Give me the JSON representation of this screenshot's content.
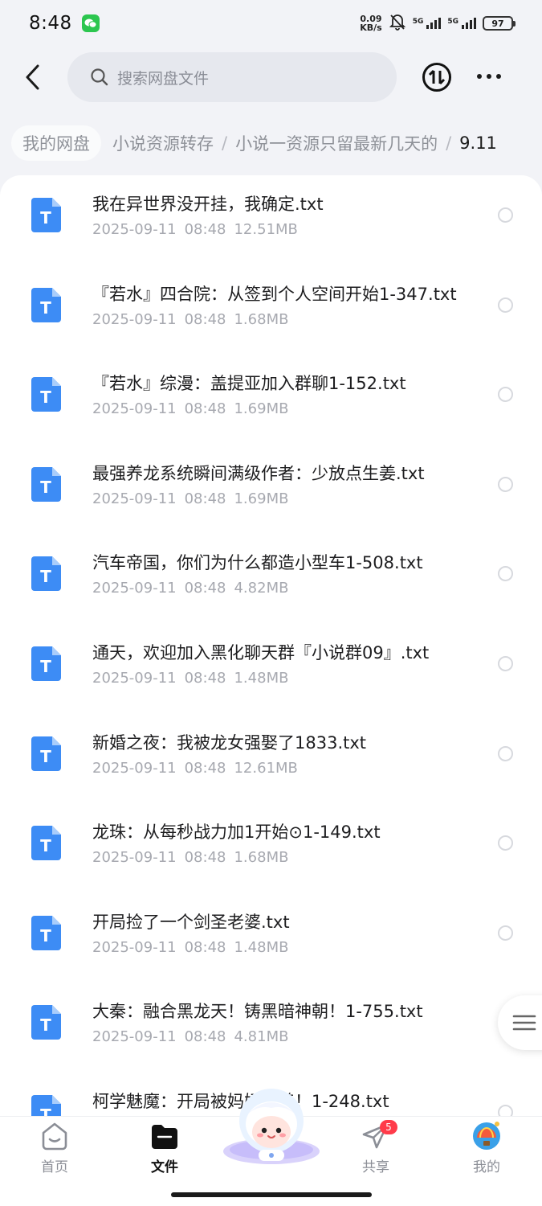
{
  "status_bar": {
    "time": "8:48",
    "net_speed_value": "0.09",
    "net_speed_unit": "KB/s",
    "network_1": "5G",
    "network_2": "5G",
    "battery": "97"
  },
  "search": {
    "placeholder": "搜索网盘文件"
  },
  "breadcrumb": {
    "root": "我的网盘",
    "items": [
      "小说资源转存",
      "小说一资源只留最新几天的"
    ],
    "separator": "/",
    "current": "9.11"
  },
  "files": [
    {
      "name": "我在异世界没开挂，我确定.txt",
      "date": "2025-09-11",
      "time": "08:48",
      "size": "12.51MB"
    },
    {
      "name": "『若水』四合院：从签到个人空间开始1-347.txt",
      "date": "2025-09-11",
      "time": "08:48",
      "size": "1.68MB"
    },
    {
      "name": "『若水』综漫：盖提亚加入群聊1-152.txt",
      "date": "2025-09-11",
      "time": "08:48",
      "size": "1.69MB"
    },
    {
      "name": "最强养龙系统瞬间满级作者：少放点生姜.txt",
      "date": "2025-09-11",
      "time": "08:48",
      "size": "1.69MB"
    },
    {
      "name": "汽车帝国，你们为什么都造小型车1-508.txt",
      "date": "2025-09-11",
      "time": "08:48",
      "size": "4.82MB"
    },
    {
      "name": "通天，欢迎加入黑化聊天群『小说群09』.txt",
      "date": "2025-09-11",
      "time": "08:48",
      "size": "1.48MB"
    },
    {
      "name": "新婚之夜：我被龙女强娶了1833.txt",
      "date": "2025-09-11",
      "time": "08:48",
      "size": "12.61MB"
    },
    {
      "name": "龙珠：从每秒战力加1开始⊙1-149.txt",
      "date": "2025-09-11",
      "time": "08:48",
      "size": "1.68MB"
    },
    {
      "name": "开局捡了一个剑圣老婆.txt",
      "date": "2025-09-11",
      "time": "08:48",
      "size": "1.48MB"
    },
    {
      "name": "大秦：融合黑龙天！铸黑暗神朝！1-755.txt",
      "date": "2025-09-11",
      "time": "08:48",
      "size": "4.81MB"
    },
    {
      "name": "柯学魅魔：开局被妈妈收养！1-248.txt",
      "date": "",
      "time": "",
      "size": ""
    }
  ],
  "file_icon_letter": "T",
  "nav": {
    "home": "首页",
    "files": "文件",
    "share": "共享",
    "share_badge": "5",
    "mine": "我的"
  },
  "colors": {
    "file_icon": "#3d8cf5",
    "background": "#f2f3f7",
    "badge": "#ff3b4a"
  }
}
